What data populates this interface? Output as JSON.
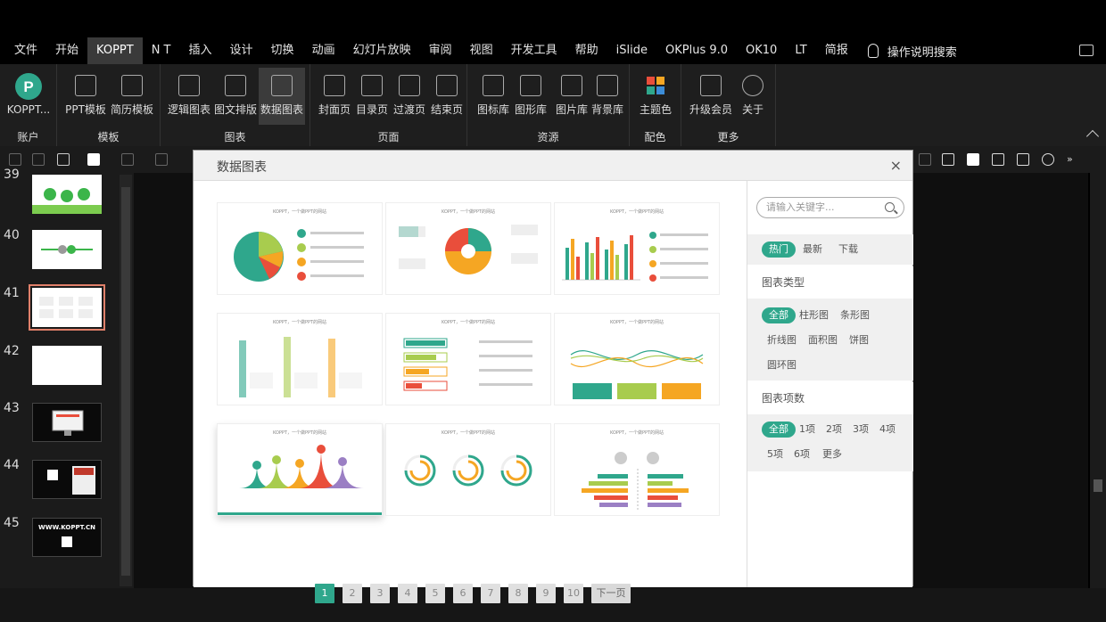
{
  "menubar": {
    "items": [
      "文件",
      "开始",
      "KOPPT",
      "N T",
      "插入",
      "设计",
      "切换",
      "动画",
      "幻灯片放映",
      "审阅",
      "视图",
      "开发工具",
      "帮助",
      "iSlide",
      "OKPlus 9.0",
      "OK10",
      "LT",
      "简报"
    ],
    "active": "KOPPT",
    "search": "操作说明搜索"
  },
  "ribbon": {
    "groups": [
      {
        "label": "账户",
        "buttons": [
          "KOPPT..."
        ]
      },
      {
        "label": "模板",
        "buttons": [
          "PPT模板",
          "简历模板"
        ]
      },
      {
        "label": "图表",
        "buttons": [
          "逻辑图表",
          "图文排版",
          "数据图表"
        ]
      },
      {
        "label": "页面",
        "buttons": [
          "封面页",
          "目录页",
          "过渡页",
          "结束页"
        ]
      },
      {
        "label": "资源",
        "buttons": [
          "图标库",
          "图形库",
          "图片库",
          "背景库"
        ]
      },
      {
        "label": "配色",
        "buttons": [
          "主题色"
        ]
      },
      {
        "label": "更多",
        "buttons": [
          "升级会员",
          "关于"
        ]
      }
    ],
    "active_button": "数据图表",
    "colors": {
      "logo": "#2fa78c"
    }
  },
  "slides": {
    "numbers": [
      "39",
      "40",
      "41",
      "42",
      "43",
      "44",
      "45"
    ],
    "selected": "41",
    "thumb_text_45": "WWW.KOPPT.CN"
  },
  "dialog": {
    "title": "数据图表",
    "close": "×",
    "card_caption": "KOPPT，一个做PPT的网站",
    "pager": {
      "pages": [
        "1",
        "2",
        "3",
        "4",
        "5",
        "6",
        "7",
        "8",
        "9",
        "10"
      ],
      "current": "1",
      "next": "下一页"
    },
    "search_placeholder": "请输入关键字...",
    "tabs": [
      "热门",
      "最新",
      "下载"
    ],
    "tabs_active": "热门",
    "chart_type_title": "图表类型",
    "chart_types": [
      "全部",
      "柱形图",
      "条形图",
      "折线图",
      "面积图",
      "饼图",
      "圆环图"
    ],
    "chart_type_active": "全部",
    "item_count_title": "图表项数",
    "item_counts": [
      "全部",
      "1项",
      "2项",
      "3项",
      "4项",
      "5项",
      "6项",
      "更多"
    ],
    "item_count_active": "全部",
    "accent": "#2fa78c"
  }
}
